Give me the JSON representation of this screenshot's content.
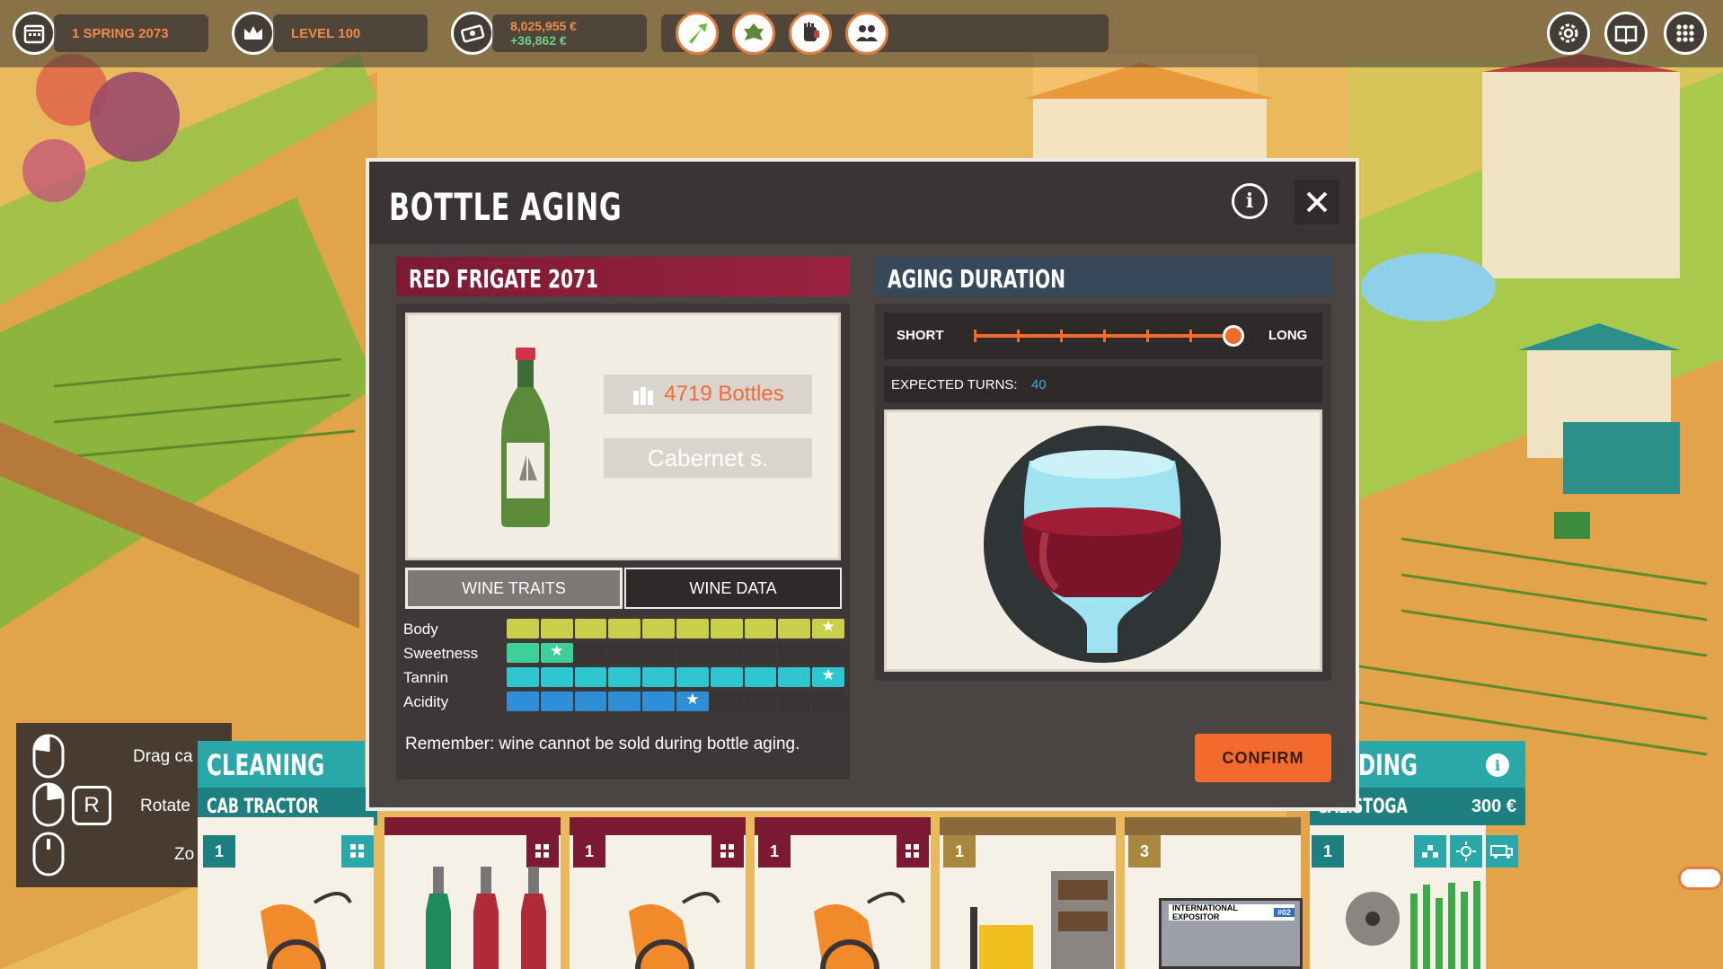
{
  "hud": {
    "date": "1 SPRING 2073",
    "level": "LEVEL 100",
    "money": "8,025,955 €",
    "income": "+36,862 €"
  },
  "modal": {
    "title": "BOTTLE AGING",
    "wine": {
      "name": "RED FRIGATE 2071",
      "bottles": "4719 Bottles",
      "grape": "Cabernet s."
    },
    "tabs": [
      "WINE TRAITS",
      "WINE DATA"
    ],
    "traits": [
      {
        "label": "Body",
        "filled": 10,
        "color": "#c9cf4a"
      },
      {
        "label": "Sweetness",
        "filled": 2,
        "color": "#3fcf9a"
      },
      {
        "label": "Tannin",
        "filled": 10,
        "color": "#2fc7cf"
      },
      {
        "label": "Acidity",
        "filled": 6,
        "color": "#2f8fd6"
      }
    ],
    "reminder": "Remember: wine cannot be sold during bottle aging.",
    "aging": {
      "title": "AGING DURATION",
      "short_label": "SHORT",
      "long_label": "LONG",
      "slider_level": 1.0,
      "turns_label": "EXPECTED TURNS:",
      "turns_value": "40"
    },
    "confirm": "CONFIRM"
  },
  "controls": {
    "drag": "Drag ca",
    "rotate": "Rotate",
    "zoom": "Zo",
    "rotate_key": "R"
  },
  "cards": {
    "cleaning_title": "CLEANING",
    "cleaning_sub": "CAB TRACTOR",
    "cleaning_num": "1",
    "trading_title": "DING",
    "trading_sub": "CALISTOGA",
    "trading_price": "300 €",
    "trading_num": "1",
    "mid_nums": [
      "1",
      "1",
      "1",
      "3"
    ],
    "expo_label": "INTERNATIONAL EXPOSITOR",
    "expo_tag": "#02"
  },
  "colors": {
    "accent": "#f26b2d",
    "wine_banner": "#7d1a33",
    "aging_banner": "#36485a",
    "teal": "#2aa7a8"
  }
}
